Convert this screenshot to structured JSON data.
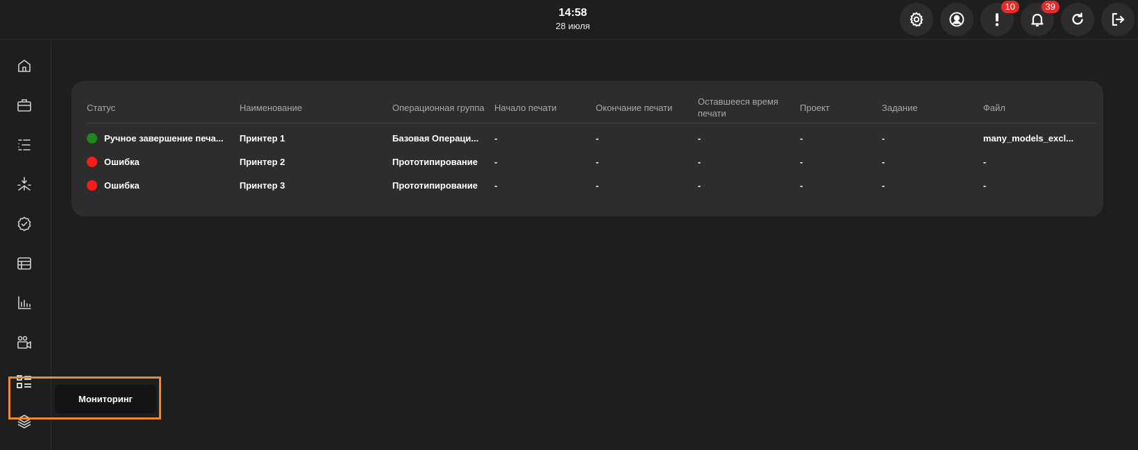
{
  "header": {
    "time": "14:58",
    "date": "28 июля",
    "buttons": [
      {
        "icon": "gear-icon"
      },
      {
        "icon": "user-circle-icon"
      },
      {
        "icon": "exclamation-icon",
        "badge": "10"
      },
      {
        "icon": "bell-icon",
        "badge": "39"
      },
      {
        "icon": "refresh-icon"
      },
      {
        "icon": "logout-icon"
      }
    ]
  },
  "sidebar": {
    "items": [
      {
        "icon": "home-icon"
      },
      {
        "icon": "briefcase-icon"
      },
      {
        "icon": "list-tree-icon"
      },
      {
        "icon": "merge-arrow-icon"
      },
      {
        "icon": "check-badge-icon"
      },
      {
        "icon": "table-icon"
      },
      {
        "icon": "bar-chart-icon"
      },
      {
        "icon": "people-camera-icon"
      },
      {
        "icon": "monitoring-grid-icon",
        "active": true
      },
      {
        "icon": "layers-icon"
      }
    ],
    "tooltip": "Мониторинг"
  },
  "table": {
    "columns": [
      "Статус",
      "Наименование",
      "Операционная группа",
      "Начало печати",
      "Окончание печати",
      "Оставшееся время печати",
      "Проект",
      "Задание",
      "Файл"
    ],
    "rows": [
      {
        "status_color": "#1a8a1a",
        "status": "Ручное завершение печа...",
        "name": "Принтер 1",
        "group": "Базовая Операци...",
        "start": "-",
        "end": "-",
        "remaining": "-",
        "project": "-",
        "task": "-",
        "file": "many_models_excl..."
      },
      {
        "status_color": "#ff1a1a",
        "status": "Ошибка",
        "name": "Принтер 2",
        "group": "Прототипирование",
        "start": "-",
        "end": "-",
        "remaining": "-",
        "project": "-",
        "task": "-",
        "file": "-"
      },
      {
        "status_color": "#ff1a1a",
        "status": "Ошибка",
        "name": "Принтер 3",
        "group": "Прототипирование",
        "start": "-",
        "end": "-",
        "remaining": "-",
        "project": "-",
        "task": "-",
        "file": "-"
      }
    ]
  },
  "colors": {
    "accent_highlight": "#f08a2e",
    "badge": "#e32b2b"
  }
}
